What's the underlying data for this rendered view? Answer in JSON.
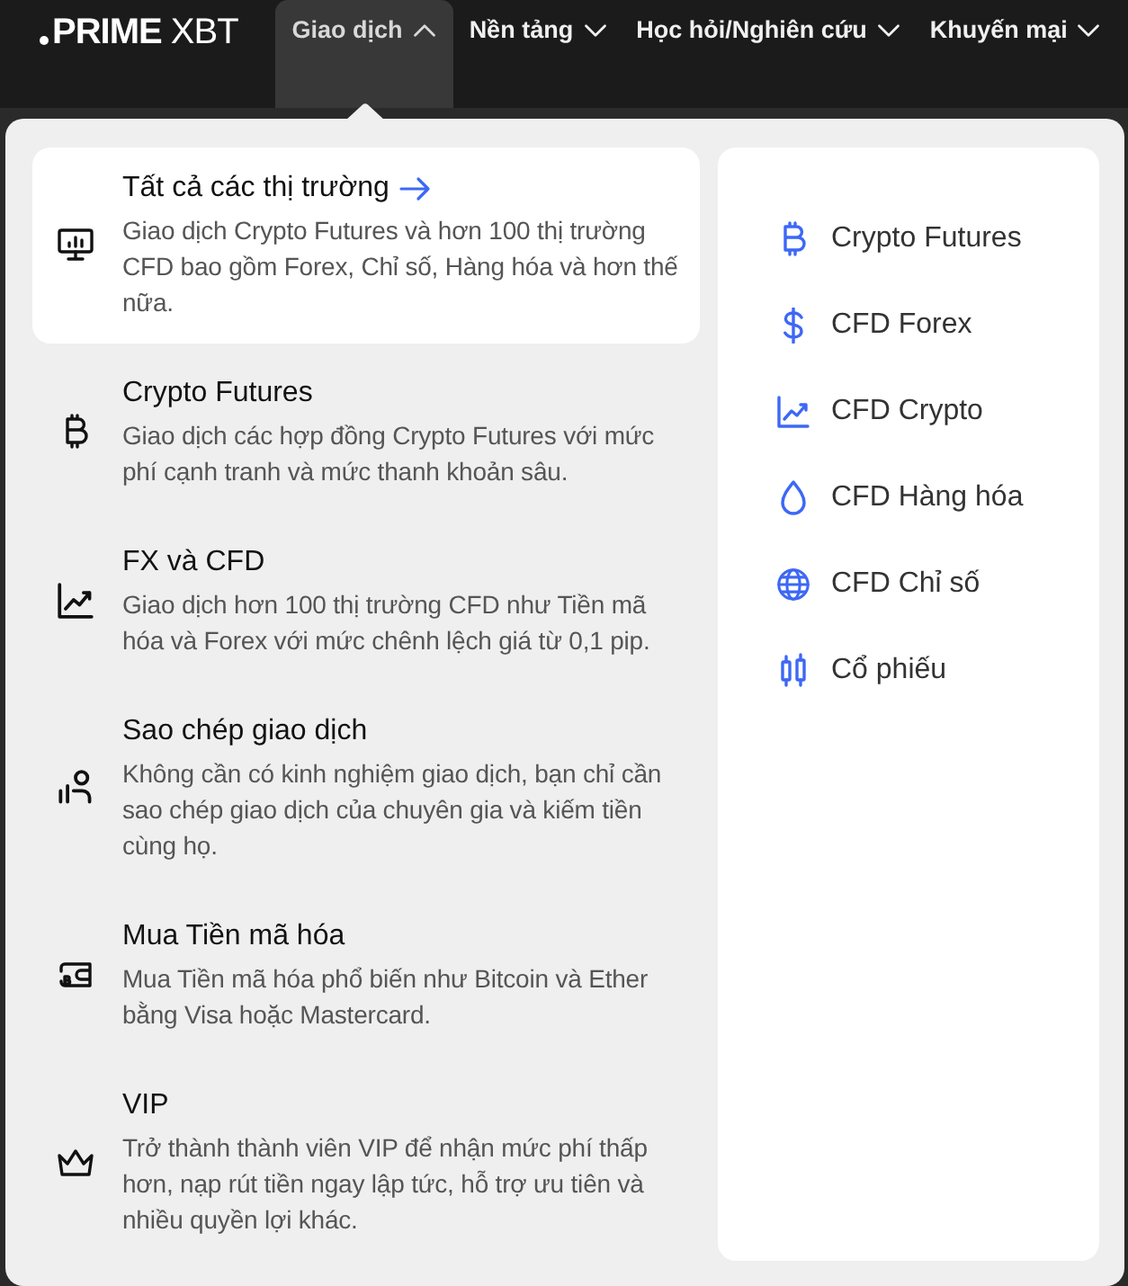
{
  "navbar": {
    "logo": "**PRIME** XBT",
    "menu": [
      {
        "label": "Giao dịch",
        "selected": true,
        "expanded": true
      },
      {
        "label": "Nền tảng",
        "selected": false,
        "expanded": false
      },
      {
        "label": "Học hỏi/Nghiên cứu",
        "selected": false,
        "expanded": false
      },
      {
        "label": "Khuyến mại",
        "selected": false,
        "expanded": false
      }
    ]
  },
  "dropdown": {
    "products": [
      {
        "title": "Tất cả các thị trường",
        "link_arrow": true,
        "selected": true,
        "description": "Giao dịch Crypto Futures và hơn 100 thị trường CFD bao gồm Forex, Chỉ số, Hàng hóa và hơn thế nữa."
      },
      {
        "title": "Crypto Futures",
        "link_arrow": false,
        "selected": false,
        "description": "Giao dịch các hợp đồng Crypto Futures với mức phí cạnh tranh và mức thanh khoản sâu."
      },
      {
        "title": "FX và CFD",
        "link_arrow": false,
        "selected": false,
        "description": "Giao dịch hơn 100 thị trường CFD như Tiền mã hóa và Forex với mức chênh lệch giá từ 0,1 pip."
      },
      {
        "title": "Sao chép giao dịch",
        "link_arrow": false,
        "selected": false,
        "description": "Không cần có kinh nghiệm giao dịch, bạn chỉ cần sao chép giao dịch của chuyên gia và kiếm tiền cùng họ."
      },
      {
        "title": "Mua Tiền mã hóa",
        "link_arrow": false,
        "selected": false,
        "description": "Mua Tiền mã hóa phổ biến như Bitcoin và Ether bằng Visa hoặc Mastercard."
      },
      {
        "title": "VIP",
        "link_arrow": false,
        "selected": false,
        "description": "Trở thành thành viên VIP để nhận mức phí thấp hơn, nạp rút tiền ngay lập tức, hỗ trợ ưu tiên và nhiều quyền lợi khác."
      }
    ],
    "markets": [
      {
        "label": "Crypto Futures"
      },
      {
        "label": "CFD Forex"
      },
      {
        "label": "CFD Crypto"
      },
      {
        "label": "CFD Hàng hóa"
      },
      {
        "label": "CFD Chỉ số"
      },
      {
        "label": "Cổ phiếu"
      }
    ]
  }
}
